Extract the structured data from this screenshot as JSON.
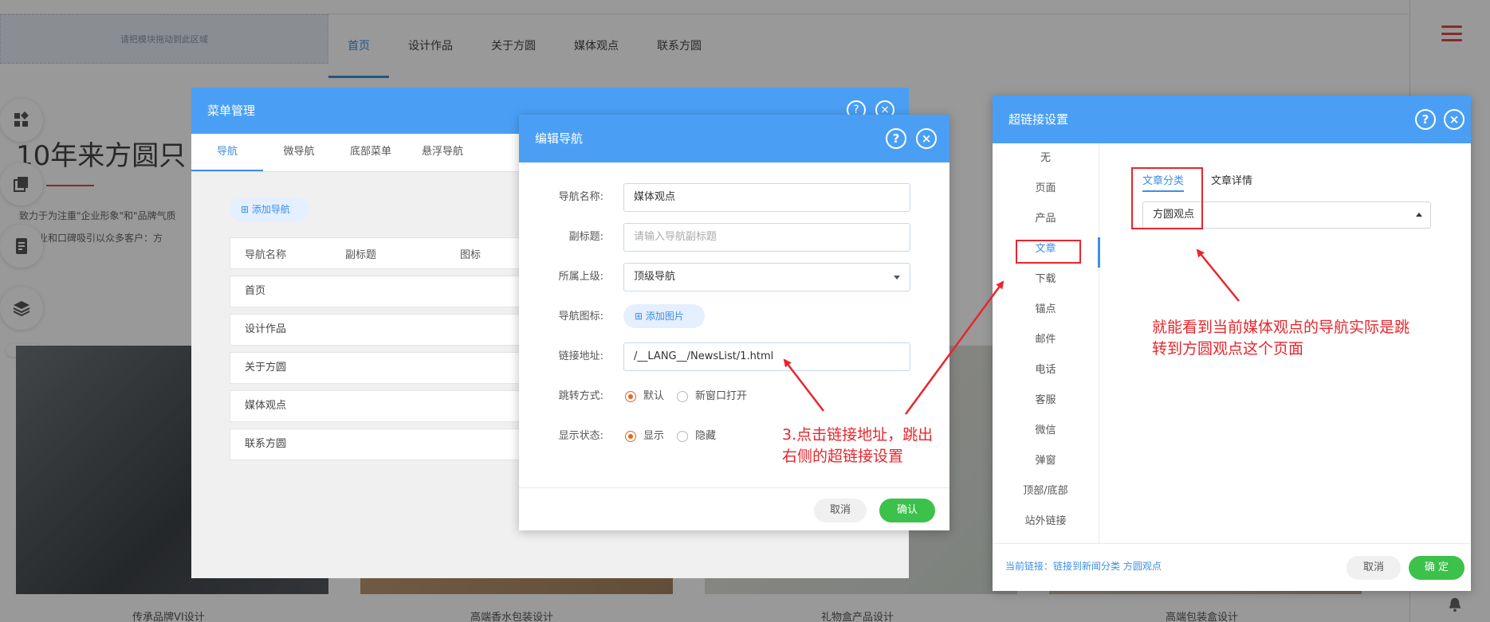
{
  "background": {
    "drop_zone_text": "请把模块拖动到此区域",
    "site_nav": [
      "首页",
      "设计作品",
      "关于方圆",
      "媒体观点",
      "联系方圆"
    ],
    "hero_title": "10年来方圆只",
    "hero_text_1": "致力于为注重\"企业形象\"和\"品牌气质",
    "hero_text_2": "的专业和口碑吸引以众多客户：方",
    "captions": [
      "传承品牌VI设计",
      "高端香水包装设计",
      "礼物盒产品设计",
      "高端包装盒设计"
    ],
    "handle_glyph": "::::::"
  },
  "menu_dialog": {
    "title": "菜单管理",
    "help": "?",
    "close": "×",
    "tabs": [
      "导航",
      "微导航",
      "底部菜单",
      "悬浮导航"
    ],
    "add_button": "添加导航",
    "columns": [
      "导航名称",
      "副标题",
      "图标"
    ],
    "rows": [
      "首页",
      "设计作品",
      "关于方圆",
      "媒体观点",
      "联系方圆"
    ]
  },
  "edit_dialog": {
    "title": "编辑导航",
    "help": "?",
    "close": "×",
    "labels": {
      "name": "导航名称:",
      "subtitle": "副标题:",
      "parent": "所属上级:",
      "icon": "导航图标:",
      "link": "链接地址:",
      "jump": "跳转方式:",
      "display": "显示状态:"
    },
    "name_value": "媒体观点",
    "subtitle_placeholder": "请输入导航副标题",
    "parent_value": "顶级导航",
    "add_image": "添加图片",
    "link_value": "/__LANG__/NewsList/1.html",
    "jump_options": [
      "默认",
      "新窗口打开"
    ],
    "display_options": [
      "显示",
      "隐藏"
    ],
    "cancel": "取消",
    "confirm": "确认"
  },
  "link_dialog": {
    "title": "超链接设置",
    "help": "?",
    "close": "×",
    "menu": [
      "无",
      "页面",
      "产品",
      "文章",
      "下载",
      "锚点",
      "邮件",
      "电话",
      "客服",
      "微信",
      "弹窗",
      "顶部/底部",
      "站外链接"
    ],
    "active_menu": "文章",
    "tabs": [
      "文章分类",
      "文章详情"
    ],
    "select_value": "方圆观点",
    "current_link": "当前链接：链接到新闻分类 方圆观点",
    "cancel": "取消",
    "confirm": "确 定"
  },
  "annotations": {
    "step3_line1": "3.点击链接地址，跳出",
    "step3_line2": "右侧的超链接设置",
    "note_line1": "就能看到当前媒体观点的导航实际是跳",
    "note_line2": "转到方圆观点这个页面"
  },
  "colors": {
    "primary": "#4a9ff5",
    "confirm_green": "#3cc14b",
    "radio_orange": "#e8641c",
    "annotation_red": "#e8262c"
  }
}
